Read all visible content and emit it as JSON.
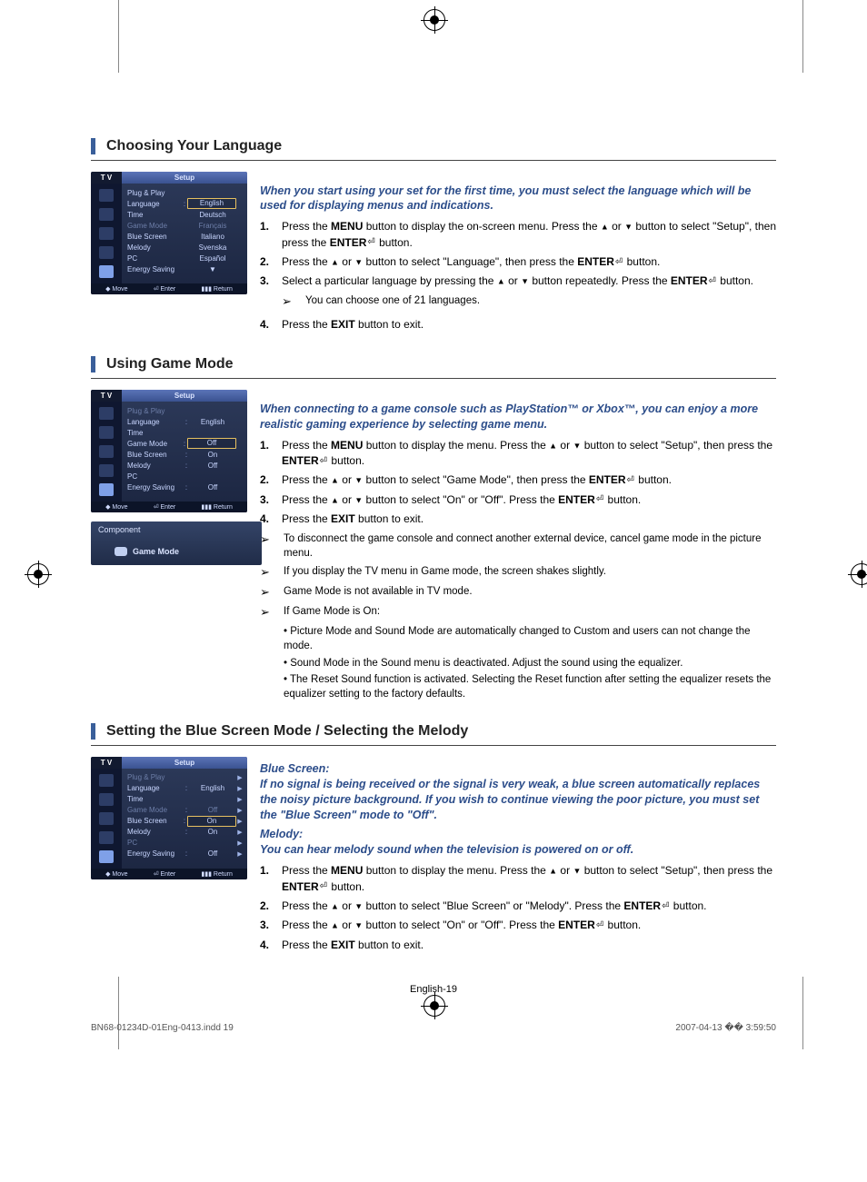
{
  "section1": {
    "title": "Choosing Your Language",
    "intro": "When you start using your set for the first time, you must select the language which will be used for displaying menus and indications.",
    "steps": [
      "Press the <b>MENU</b> button to display the on-screen menu. Press the <span class='tri'>▲</span> or <span class='tri'>▼</span> button to select \"Setup\", then press the <b>ENTER</b><span class='enter-glyph'>⏎</span> button.",
      "Press the <span class='tri'>▲</span> or <span class='tri'>▼</span> button to select \"Language\", then press the <b>ENTER</b><span class='enter-glyph'>⏎</span> button.",
      "Select a particular language by pressing the <span class='tri'>▲</span> or <span class='tri'>▼</span> button repeatedly. Press the <b>ENTER</b><span class='enter-glyph'>⏎</span> button.<div class='arrow-note' style='margin-left:0;'><span class='arrow-sym'>➢</span><span class='arrow-body'>You can choose one of 21 languages.</span></div>",
      "Press the <b>EXIT</b> button to exit."
    ],
    "osd": {
      "tv": "T V",
      "title": "Setup",
      "items": [
        {
          "label": "Plug & Play",
          "sep": "",
          "val": "",
          "arrow": "",
          "class": ""
        },
        {
          "label": "Language",
          "sep": ":",
          "val": "English",
          "arrow": "",
          "class": "",
          "boxed": true
        },
        {
          "label": "Time",
          "sep": "",
          "val": "Deutsch",
          "arrow": "",
          "class": ""
        },
        {
          "label": "Game Mode",
          "sep": "",
          "val": "Français",
          "arrow": "",
          "class": "dim"
        },
        {
          "label": "Blue Screen",
          "sep": "",
          "val": "Italiano",
          "arrow": "",
          "class": ""
        },
        {
          "label": "Melody",
          "sep": "",
          "val": "Svenska",
          "arrow": "",
          "class": ""
        },
        {
          "label": "PC",
          "sep": "",
          "val": "Español",
          "arrow": "",
          "class": ""
        },
        {
          "label": "Energy Saving",
          "sep": "",
          "val": "▼",
          "arrow": "",
          "class": ""
        }
      ],
      "foot": {
        "move": "Move",
        "enter": "Enter",
        "ret": "Return"
      }
    }
  },
  "section2": {
    "title": "Using Game Mode",
    "intro": "When connecting to a game console such as PlayStation™ or Xbox™, you can enjoy a more realistic gaming experience by selecting game menu.",
    "steps": [
      "Press the <b>MENU</b> button to display the menu. Press the <span class='tri'>▲</span> or <span class='tri'>▼</span> button to select \"Setup\", then press the <b>ENTER</b><span class='enter-glyph'>⏎</span> button.",
      "Press the <span class='tri'>▲</span> or <span class='tri'>▼</span> button to select \"Game Mode\", then press the <b>ENTER</b><span class='enter-glyph'>⏎</span> button.",
      "Press the <span class='tri'>▲</span> or <span class='tri'>▼</span> button to select \"On\" or \"Off\". Press the <b>ENTER</b><span class='enter-glyph'>⏎</span> button.",
      "Press the <b>EXIT</b> button to exit."
    ],
    "notes": [
      "To disconnect the game console and connect another external device, cancel game mode in the picture menu.",
      "If you display the TV menu in Game mode, the screen shakes slightly.",
      "Game Mode is not available in TV mode.",
      "If Game Mode is On:"
    ],
    "subbullets": [
      "• Picture Mode and Sound Mode are automatically changed to Custom and users can not change the mode.",
      "• Sound Mode in the Sound menu is deactivated. Adjust the sound using the equalizer.",
      "• The Reset Sound function is activated. Selecting the Reset function after setting the equalizer resets the equalizer setting to the factory defaults."
    ],
    "osd": {
      "tv": "T V",
      "title": "Setup",
      "items": [
        {
          "label": "Plug & Play",
          "sep": "",
          "val": "",
          "arrow": "",
          "class": "dim"
        },
        {
          "label": "Language",
          "sep": ":",
          "val": "English",
          "arrow": "",
          "class": ""
        },
        {
          "label": "Time",
          "sep": "",
          "val": "",
          "arrow": "",
          "class": ""
        },
        {
          "label": "Game Mode",
          "sep": ":",
          "val": "Off",
          "arrow": "",
          "class": "",
          "boxed": true
        },
        {
          "label": "Blue Screen",
          "sep": ":",
          "val": "On",
          "arrow": "",
          "class": ""
        },
        {
          "label": "Melody",
          "sep": ":",
          "val": "Off",
          "arrow": "",
          "class": ""
        },
        {
          "label": "PC",
          "sep": "",
          "val": "",
          "arrow": "",
          "class": ""
        },
        {
          "label": "Energy Saving",
          "sep": ":",
          "val": "Off",
          "arrow": "",
          "class": ""
        }
      ],
      "foot": {
        "move": "Move",
        "enter": "Enter",
        "ret": "Return"
      }
    },
    "subosd": {
      "component": "Component",
      "gamemode": "Game Mode"
    }
  },
  "section3": {
    "title": "Setting the Blue Screen Mode / Selecting the Melody",
    "bluehead": "Blue Screen:",
    "blueintro": "If no signal is being received or the signal is very weak, a blue screen automatically replaces the noisy picture background. If you wish to continue viewing the poor picture, you must set the \"Blue Screen\" mode to \"Off\".",
    "melhead": "Melody:",
    "melintro": "You can hear melody sound when the television is powered on or off.",
    "steps": [
      "Press the <b>MENU</b> button to display the menu. Press the <span class='tri'>▲</span> or <span class='tri'>▼</span> button to select \"Setup\", then press the <b>ENTER</b><span class='enter-glyph'>⏎</span> button.",
      "Press the <span class='tri'>▲</span> or <span class='tri'>▼</span> button to select \"Blue Screen\" or \"Melody\". Press the <b>ENTER</b><span class='enter-glyph'>⏎</span> button.",
      "Press the <span class='tri'>▲</span> or <span class='tri'>▼</span> button to select \"On\" or \"Off\". Press the <b>ENTER</b><span class='enter-glyph'>⏎</span> button.",
      "Press the <b>EXIT</b> button to exit."
    ],
    "osd": {
      "tv": "T V",
      "title": "Setup",
      "items": [
        {
          "label": "Plug & Play",
          "sep": "",
          "val": "",
          "arrow": "▶",
          "class": "dim"
        },
        {
          "label": "Language",
          "sep": ":",
          "val": "English",
          "arrow": "▶",
          "class": ""
        },
        {
          "label": "Time",
          "sep": "",
          "val": "",
          "arrow": "▶",
          "class": ""
        },
        {
          "label": "Game Mode",
          "sep": ":",
          "val": "Off",
          "arrow": "▶",
          "class": "dim"
        },
        {
          "label": "Blue Screen",
          "sep": ":",
          "val": "On",
          "arrow": "▶",
          "class": "",
          "boxed": true
        },
        {
          "label": "Melody",
          "sep": ":",
          "val": "On",
          "arrow": "▶",
          "class": ""
        },
        {
          "label": "PC",
          "sep": "",
          "val": "",
          "arrow": "▶",
          "class": "dim"
        },
        {
          "label": "Energy Saving",
          "sep": ":",
          "val": "Off",
          "arrow": "▶",
          "class": ""
        }
      ],
      "foot": {
        "move": "Move",
        "enter": "Enter",
        "ret": "Return"
      }
    }
  },
  "footer_page": "English-19",
  "print_left": "BN68-01234D-01Eng-0413.indd   19",
  "print_right": "2007-04-13   �� 3:59:50"
}
